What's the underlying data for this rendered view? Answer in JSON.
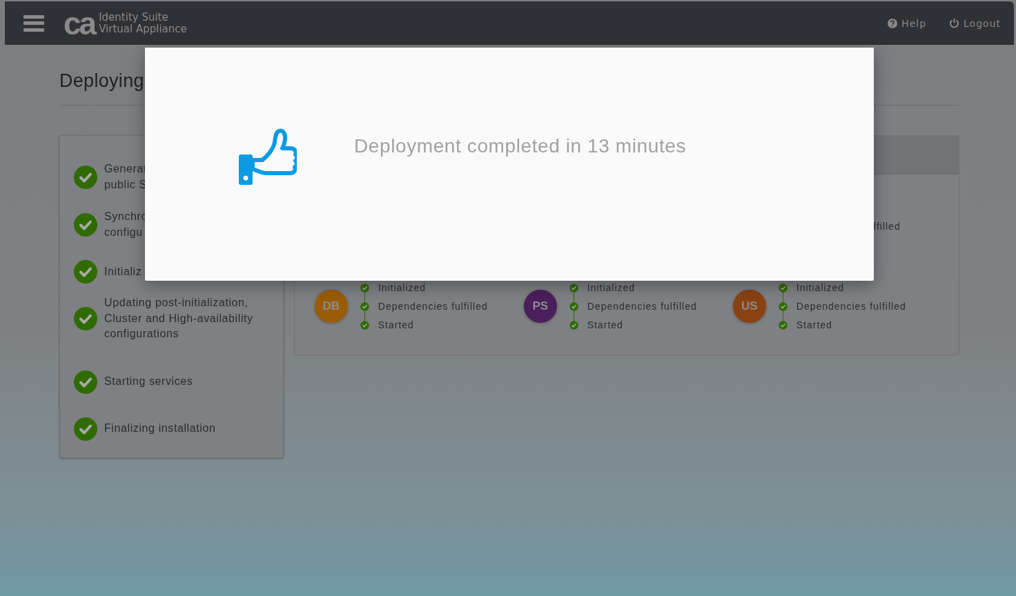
{
  "navbar": {
    "logo": "ca",
    "brand_line1": "Identity Suite",
    "brand_line2": "Virtual Appliance",
    "links": [
      {
        "label": "Help"
      },
      {
        "label": "Logout"
      }
    ]
  },
  "page": {
    "title": "Deploying"
  },
  "steps": [
    {
      "text": "Generat\npublic S",
      "done": true
    },
    {
      "text": "Synchro\nconfigu",
      "done": true
    },
    {
      "text": "Initializ",
      "done": true
    },
    {
      "text": "Updating post-initialization,\nCluster and High-availability\nconfigurations",
      "done": true
    },
    {
      "text": "Starting services",
      "done": true
    },
    {
      "text": "Finalizing installation",
      "done": true
    }
  ],
  "services": {
    "fragment": "lfilled",
    "groups": [
      {
        "abbr": "DB",
        "color": "#9b5c07",
        "statuses": [
          {
            "label": "Initialized",
            "done": true
          },
          {
            "label": "Dependencies fulfilled",
            "done": true
          },
          {
            "label": "Started",
            "done": true
          }
        ]
      },
      {
        "abbr": "PS",
        "color": "#4a1f5c",
        "statuses": [
          {
            "label": "Initialized",
            "done": true
          },
          {
            "label": "Dependencies fulfilled",
            "done": true
          },
          {
            "label": "Started",
            "done": true
          }
        ]
      },
      {
        "abbr": "US",
        "color": "#8a4211",
        "statuses": [
          {
            "label": "Initialized",
            "done": true
          },
          {
            "label": "Dependencies fulfilled",
            "done": true
          },
          {
            "label": "Started",
            "done": true
          }
        ]
      }
    ]
  },
  "modal": {
    "message": "Deployment completed in 13 minutes"
  }
}
